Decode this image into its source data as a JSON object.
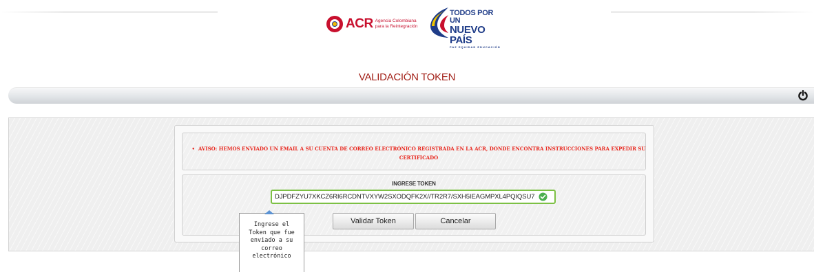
{
  "header": {
    "acr_logo": {
      "acronym": "ACR",
      "subtitle_line1": "Agencia Colombiana",
      "subtitle_line2": "para la Reintegración"
    },
    "gov_logo": {
      "line1": "TODOS POR UN",
      "line2": "NUEVO PAÍS",
      "line3": "PAZ  EQUIDAD  EDUCACIÓN"
    }
  },
  "page": {
    "title": "VALIDACIÓN TOKEN"
  },
  "top_bar": {
    "power_icon": "power-icon"
  },
  "notice": {
    "bullet": "•",
    "text": "AVISO: HEMOS ENVIADO UN EMAIL A SU CUENTA DE CORREO ELECTRÓNICO REGISTRADA EN LA ACR, DONDE ENCONTRA INSTRUCCIONES PARA EXPEDIR SU CERTIFICADO"
  },
  "token_form": {
    "label": "INGRESE TOKEN",
    "token_value": "DJPDFZYU7XKCZ6RI6RCDNTVXYW2SXODQFK2X//TR2R7/SXH5IEAGMPXL4PQIQSU7",
    "valid_icon": "check-circle-icon"
  },
  "buttons": {
    "validate_label": "Validar Token",
    "cancel_label": "Cancelar"
  },
  "tooltip": {
    "text": "Ingrese el Token que fue enviado a su correo electrónico"
  },
  "colors": {
    "title_red": "#a3221a",
    "notice_red": "#e8261d",
    "input_valid_green": "#7cc044",
    "tooltip_arrow_blue": "#5b93d4"
  }
}
